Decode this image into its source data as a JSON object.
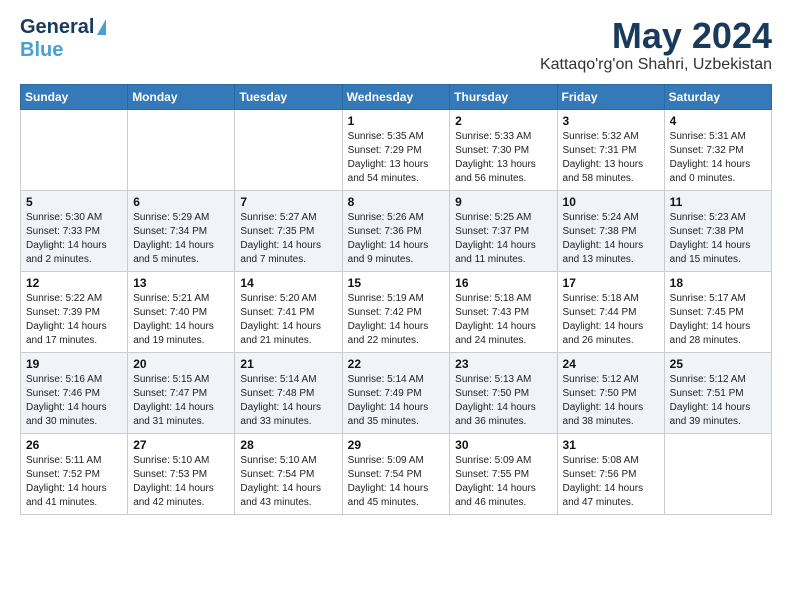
{
  "header": {
    "logo_line1": "General",
    "logo_line2": "Blue",
    "month": "May 2024",
    "location": "Kattaqo'rg'on Shahri, Uzbekistan"
  },
  "days_of_week": [
    "Sunday",
    "Monday",
    "Tuesday",
    "Wednesday",
    "Thursday",
    "Friday",
    "Saturday"
  ],
  "weeks": [
    [
      {
        "day": "",
        "sunrise": "",
        "sunset": "",
        "daylight": ""
      },
      {
        "day": "",
        "sunrise": "",
        "sunset": "",
        "daylight": ""
      },
      {
        "day": "",
        "sunrise": "",
        "sunset": "",
        "daylight": ""
      },
      {
        "day": "1",
        "sunrise": "Sunrise: 5:35 AM",
        "sunset": "Sunset: 7:29 PM",
        "daylight": "Daylight: 13 hours and 54 minutes."
      },
      {
        "day": "2",
        "sunrise": "Sunrise: 5:33 AM",
        "sunset": "Sunset: 7:30 PM",
        "daylight": "Daylight: 13 hours and 56 minutes."
      },
      {
        "day": "3",
        "sunrise": "Sunrise: 5:32 AM",
        "sunset": "Sunset: 7:31 PM",
        "daylight": "Daylight: 13 hours and 58 minutes."
      },
      {
        "day": "4",
        "sunrise": "Sunrise: 5:31 AM",
        "sunset": "Sunset: 7:32 PM",
        "daylight": "Daylight: 14 hours and 0 minutes."
      }
    ],
    [
      {
        "day": "5",
        "sunrise": "Sunrise: 5:30 AM",
        "sunset": "Sunset: 7:33 PM",
        "daylight": "Daylight: 14 hours and 2 minutes."
      },
      {
        "day": "6",
        "sunrise": "Sunrise: 5:29 AM",
        "sunset": "Sunset: 7:34 PM",
        "daylight": "Daylight: 14 hours and 5 minutes."
      },
      {
        "day": "7",
        "sunrise": "Sunrise: 5:27 AM",
        "sunset": "Sunset: 7:35 PM",
        "daylight": "Daylight: 14 hours and 7 minutes."
      },
      {
        "day": "8",
        "sunrise": "Sunrise: 5:26 AM",
        "sunset": "Sunset: 7:36 PM",
        "daylight": "Daylight: 14 hours and 9 minutes."
      },
      {
        "day": "9",
        "sunrise": "Sunrise: 5:25 AM",
        "sunset": "Sunset: 7:37 PM",
        "daylight": "Daylight: 14 hours and 11 minutes."
      },
      {
        "day": "10",
        "sunrise": "Sunrise: 5:24 AM",
        "sunset": "Sunset: 7:38 PM",
        "daylight": "Daylight: 14 hours and 13 minutes."
      },
      {
        "day": "11",
        "sunrise": "Sunrise: 5:23 AM",
        "sunset": "Sunset: 7:38 PM",
        "daylight": "Daylight: 14 hours and 15 minutes."
      }
    ],
    [
      {
        "day": "12",
        "sunrise": "Sunrise: 5:22 AM",
        "sunset": "Sunset: 7:39 PM",
        "daylight": "Daylight: 14 hours and 17 minutes."
      },
      {
        "day": "13",
        "sunrise": "Sunrise: 5:21 AM",
        "sunset": "Sunset: 7:40 PM",
        "daylight": "Daylight: 14 hours and 19 minutes."
      },
      {
        "day": "14",
        "sunrise": "Sunrise: 5:20 AM",
        "sunset": "Sunset: 7:41 PM",
        "daylight": "Daylight: 14 hours and 21 minutes."
      },
      {
        "day": "15",
        "sunrise": "Sunrise: 5:19 AM",
        "sunset": "Sunset: 7:42 PM",
        "daylight": "Daylight: 14 hours and 22 minutes."
      },
      {
        "day": "16",
        "sunrise": "Sunrise: 5:18 AM",
        "sunset": "Sunset: 7:43 PM",
        "daylight": "Daylight: 14 hours and 24 minutes."
      },
      {
        "day": "17",
        "sunrise": "Sunrise: 5:18 AM",
        "sunset": "Sunset: 7:44 PM",
        "daylight": "Daylight: 14 hours and 26 minutes."
      },
      {
        "day": "18",
        "sunrise": "Sunrise: 5:17 AM",
        "sunset": "Sunset: 7:45 PM",
        "daylight": "Daylight: 14 hours and 28 minutes."
      }
    ],
    [
      {
        "day": "19",
        "sunrise": "Sunrise: 5:16 AM",
        "sunset": "Sunset: 7:46 PM",
        "daylight": "Daylight: 14 hours and 30 minutes."
      },
      {
        "day": "20",
        "sunrise": "Sunrise: 5:15 AM",
        "sunset": "Sunset: 7:47 PM",
        "daylight": "Daylight: 14 hours and 31 minutes."
      },
      {
        "day": "21",
        "sunrise": "Sunrise: 5:14 AM",
        "sunset": "Sunset: 7:48 PM",
        "daylight": "Daylight: 14 hours and 33 minutes."
      },
      {
        "day": "22",
        "sunrise": "Sunrise: 5:14 AM",
        "sunset": "Sunset: 7:49 PM",
        "daylight": "Daylight: 14 hours and 35 minutes."
      },
      {
        "day": "23",
        "sunrise": "Sunrise: 5:13 AM",
        "sunset": "Sunset: 7:50 PM",
        "daylight": "Daylight: 14 hours and 36 minutes."
      },
      {
        "day": "24",
        "sunrise": "Sunrise: 5:12 AM",
        "sunset": "Sunset: 7:50 PM",
        "daylight": "Daylight: 14 hours and 38 minutes."
      },
      {
        "day": "25",
        "sunrise": "Sunrise: 5:12 AM",
        "sunset": "Sunset: 7:51 PM",
        "daylight": "Daylight: 14 hours and 39 minutes."
      }
    ],
    [
      {
        "day": "26",
        "sunrise": "Sunrise: 5:11 AM",
        "sunset": "Sunset: 7:52 PM",
        "daylight": "Daylight: 14 hours and 41 minutes."
      },
      {
        "day": "27",
        "sunrise": "Sunrise: 5:10 AM",
        "sunset": "Sunset: 7:53 PM",
        "daylight": "Daylight: 14 hours and 42 minutes."
      },
      {
        "day": "28",
        "sunrise": "Sunrise: 5:10 AM",
        "sunset": "Sunset: 7:54 PM",
        "daylight": "Daylight: 14 hours and 43 minutes."
      },
      {
        "day": "29",
        "sunrise": "Sunrise: 5:09 AM",
        "sunset": "Sunset: 7:54 PM",
        "daylight": "Daylight: 14 hours and 45 minutes."
      },
      {
        "day": "30",
        "sunrise": "Sunrise: 5:09 AM",
        "sunset": "Sunset: 7:55 PM",
        "daylight": "Daylight: 14 hours and 46 minutes."
      },
      {
        "day": "31",
        "sunrise": "Sunrise: 5:08 AM",
        "sunset": "Sunset: 7:56 PM",
        "daylight": "Daylight: 14 hours and 47 minutes."
      },
      {
        "day": "",
        "sunrise": "",
        "sunset": "",
        "daylight": ""
      }
    ]
  ]
}
